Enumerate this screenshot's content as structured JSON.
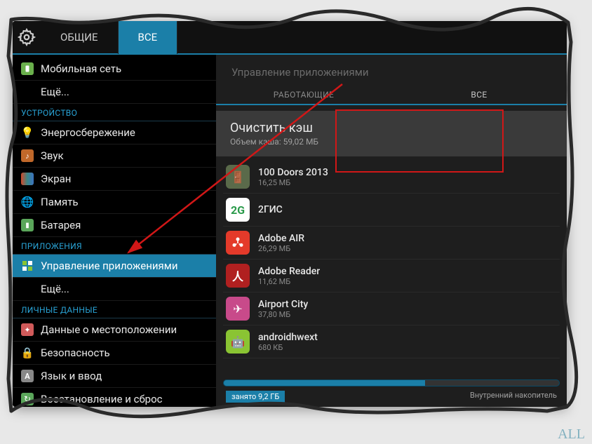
{
  "header": {
    "tabs": [
      {
        "label": "ОБЩИЕ",
        "active": false
      },
      {
        "label": "ВСЕ",
        "active": true
      }
    ]
  },
  "sidebar": {
    "top_items": [
      {
        "label": "Мобильная сеть",
        "icon": "mobile",
        "color": "#6ab04c"
      },
      {
        "label": "Ещё...",
        "icon": "",
        "color": ""
      }
    ],
    "sections": [
      {
        "header": "УСТРОЙСТВО",
        "items": [
          {
            "label": "Энергосбережение",
            "icon": "bulb",
            "color": "#f0c419"
          },
          {
            "label": "Звук",
            "icon": "sound",
            "color": "#c0682a"
          },
          {
            "label": "Экран",
            "icon": "screen",
            "color": "#3b8686"
          },
          {
            "label": "Память",
            "icon": "memory",
            "color": "#3b73c0"
          },
          {
            "label": "Батарея",
            "icon": "battery",
            "color": "#5aa65a"
          }
        ]
      },
      {
        "header": "ПРИЛОЖЕНИЯ",
        "items": [
          {
            "label": "Управление приложениями",
            "icon": "apps",
            "color": "#6ab04c",
            "active": true
          },
          {
            "label": "Ещё...",
            "icon": "",
            "color": ""
          }
        ]
      },
      {
        "header": "ЛИЧНЫЕ ДАННЫЕ",
        "items": [
          {
            "label": "Данные о местоположении",
            "icon": "location",
            "color": "#d05a5a"
          },
          {
            "label": "Безопасность",
            "icon": "lock",
            "color": "#c0682a"
          },
          {
            "label": "Язык и ввод",
            "icon": "lang",
            "color": "#888"
          },
          {
            "label": "Восстановление и сброс",
            "icon": "reset",
            "color": "#5aa65a"
          }
        ]
      }
    ]
  },
  "content": {
    "title": "Управление приложениями",
    "tabs": [
      {
        "label": "РАБОТАЮЩИЕ",
        "active": false
      },
      {
        "label": "ВСЕ",
        "active": true
      }
    ],
    "clear_cache": {
      "title": "Очистить кэш",
      "subtitle": "Объем кэша: 59,02 МБ"
    },
    "apps": [
      {
        "name": "100 Doors 2013",
        "size": "16,25 МБ",
        "color": "#5a6a4a"
      },
      {
        "name": "2ГИС",
        "size": "",
        "color": "#e8a030"
      },
      {
        "name": "Adobe AIR",
        "size": "26,29 МБ",
        "color": "#e43a2a"
      },
      {
        "name": "Adobe Reader",
        "size": "11,62 МБ",
        "color": "#b02020"
      },
      {
        "name": "Airport City",
        "size": "37,80 МБ",
        "color": "#c84a8a"
      },
      {
        "name": "androidhwext",
        "size": "680 КБ",
        "color": "#8ac433"
      }
    ],
    "storage": {
      "used": "занято 9,2 ГБ",
      "label": "Внутренний накопитель"
    }
  }
}
